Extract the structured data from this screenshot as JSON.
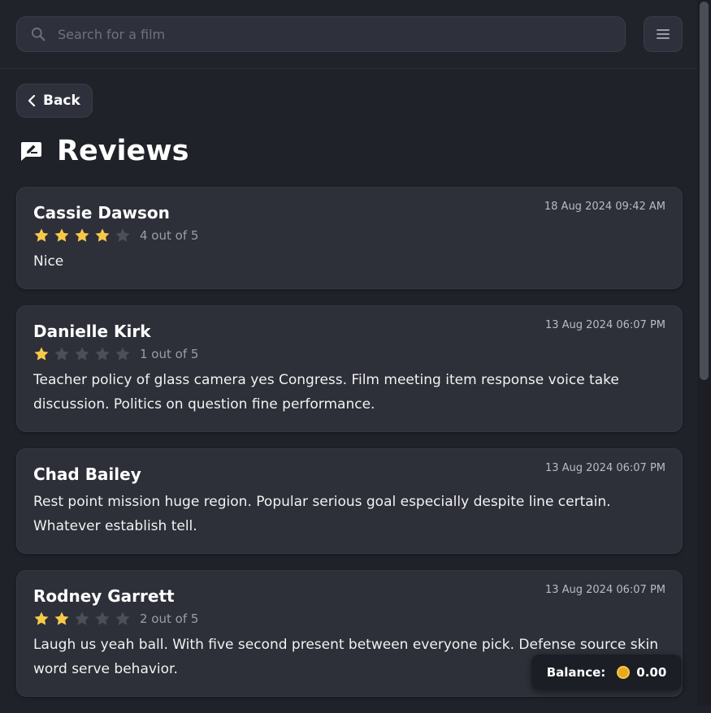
{
  "search": {
    "placeholder": "Search for a film"
  },
  "nav": {
    "back_label": "Back"
  },
  "page": {
    "title": "Reviews"
  },
  "reviews": [
    {
      "name": "Cassie Dawson",
      "date": "18 Aug 2024 09:42 AM",
      "rating": 4,
      "rating_text": "4 out of 5",
      "text": "Nice"
    },
    {
      "name": "Danielle Kirk",
      "date": "13 Aug 2024 06:07 PM",
      "rating": 1,
      "rating_text": "1 out of 5",
      "text": "Teacher policy of glass camera yes Congress. Film meeting item response voice take discussion. Politics on question fine performance."
    },
    {
      "name": "Chad Bailey",
      "date": "13 Aug 2024 06:07 PM",
      "rating": null,
      "rating_text": "",
      "text": "Rest point mission huge region. Popular serious goal especially despite line certain. Whatever establish tell."
    },
    {
      "name": "Rodney Garrett",
      "date": "13 Aug 2024 06:07 PM",
      "rating": 2,
      "rating_text": "2 out of 5",
      "text": "Laugh us yeah ball. With five second present between everyone pick. Defense source skin word serve behavior."
    }
  ],
  "balance": {
    "label": "Balance:",
    "value": "0.00"
  },
  "colors": {
    "star_filled": "#f7c948",
    "star_empty": "#4c4f59",
    "background": "#20222a",
    "card": "#2d2f39"
  },
  "icons": {
    "search": "search-icon",
    "menu": "menu-icon",
    "back": "chevron-left-icon",
    "reviews": "review-icon",
    "coin": "coin-icon"
  }
}
